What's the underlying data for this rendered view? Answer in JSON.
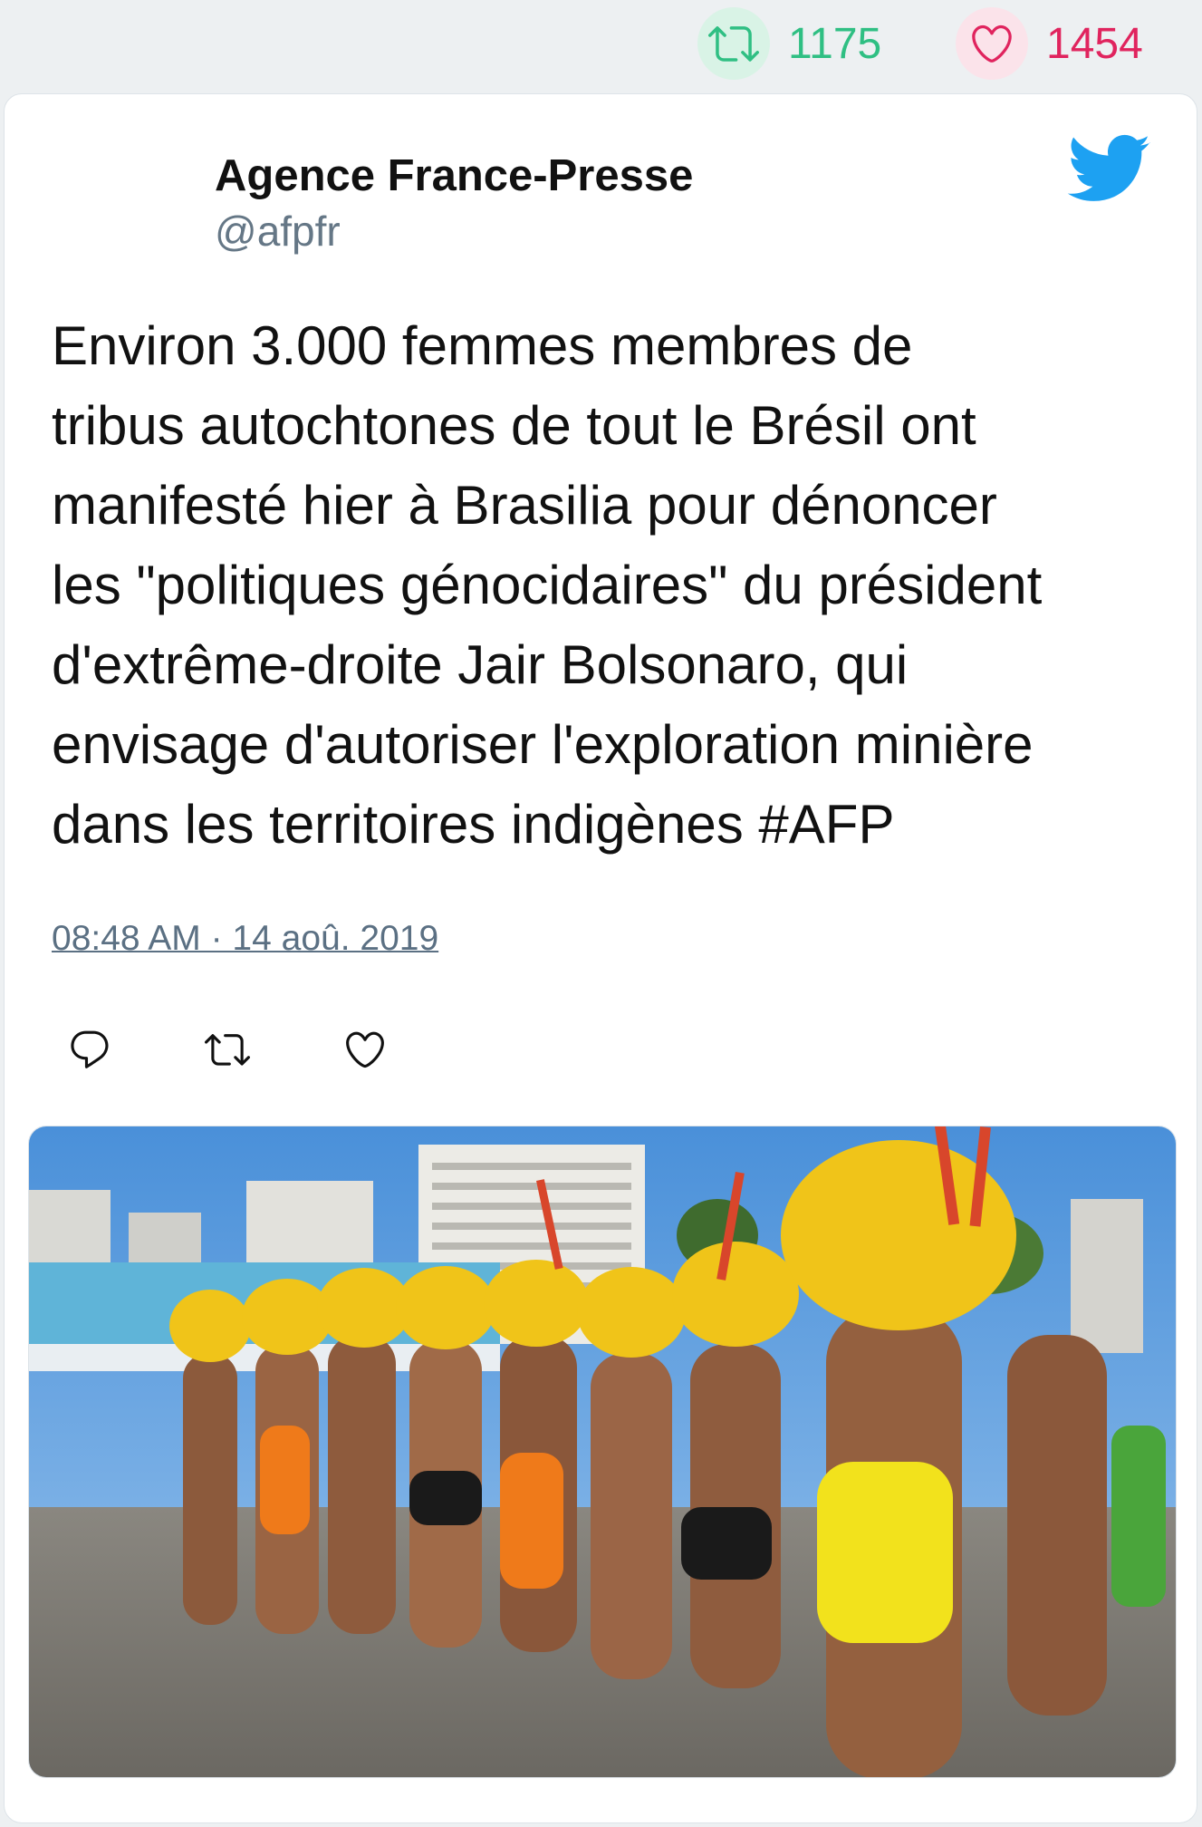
{
  "stats": {
    "retweets": "1175",
    "likes": "1454",
    "retweet_color": "#2fbf83",
    "like_color": "#e0245e"
  },
  "tweet": {
    "author_name": "Agence France-Presse",
    "author_handle": "@afpfr",
    "text": "Environ 3.000 femmes membres de\ntribus autochtones de tout le Brésil ont\nmanifesté hier à Brasilia pour dénoncer\nles \"politiques génocidaires\" du président\nd'extrême-droite Jair Bolsonaro, qui\nenvisage d'autoriser l'exploration minière\ndans les territoires indigènes #AFP",
    "timestamp": "08:48 AM · 14 aoû. 2019",
    "icons": {
      "brand": "twitter-bird-icon",
      "reply": "reply-icon",
      "retweet": "retweet-icon",
      "like": "heart-icon"
    },
    "accent_color": "#1da1f2"
  }
}
